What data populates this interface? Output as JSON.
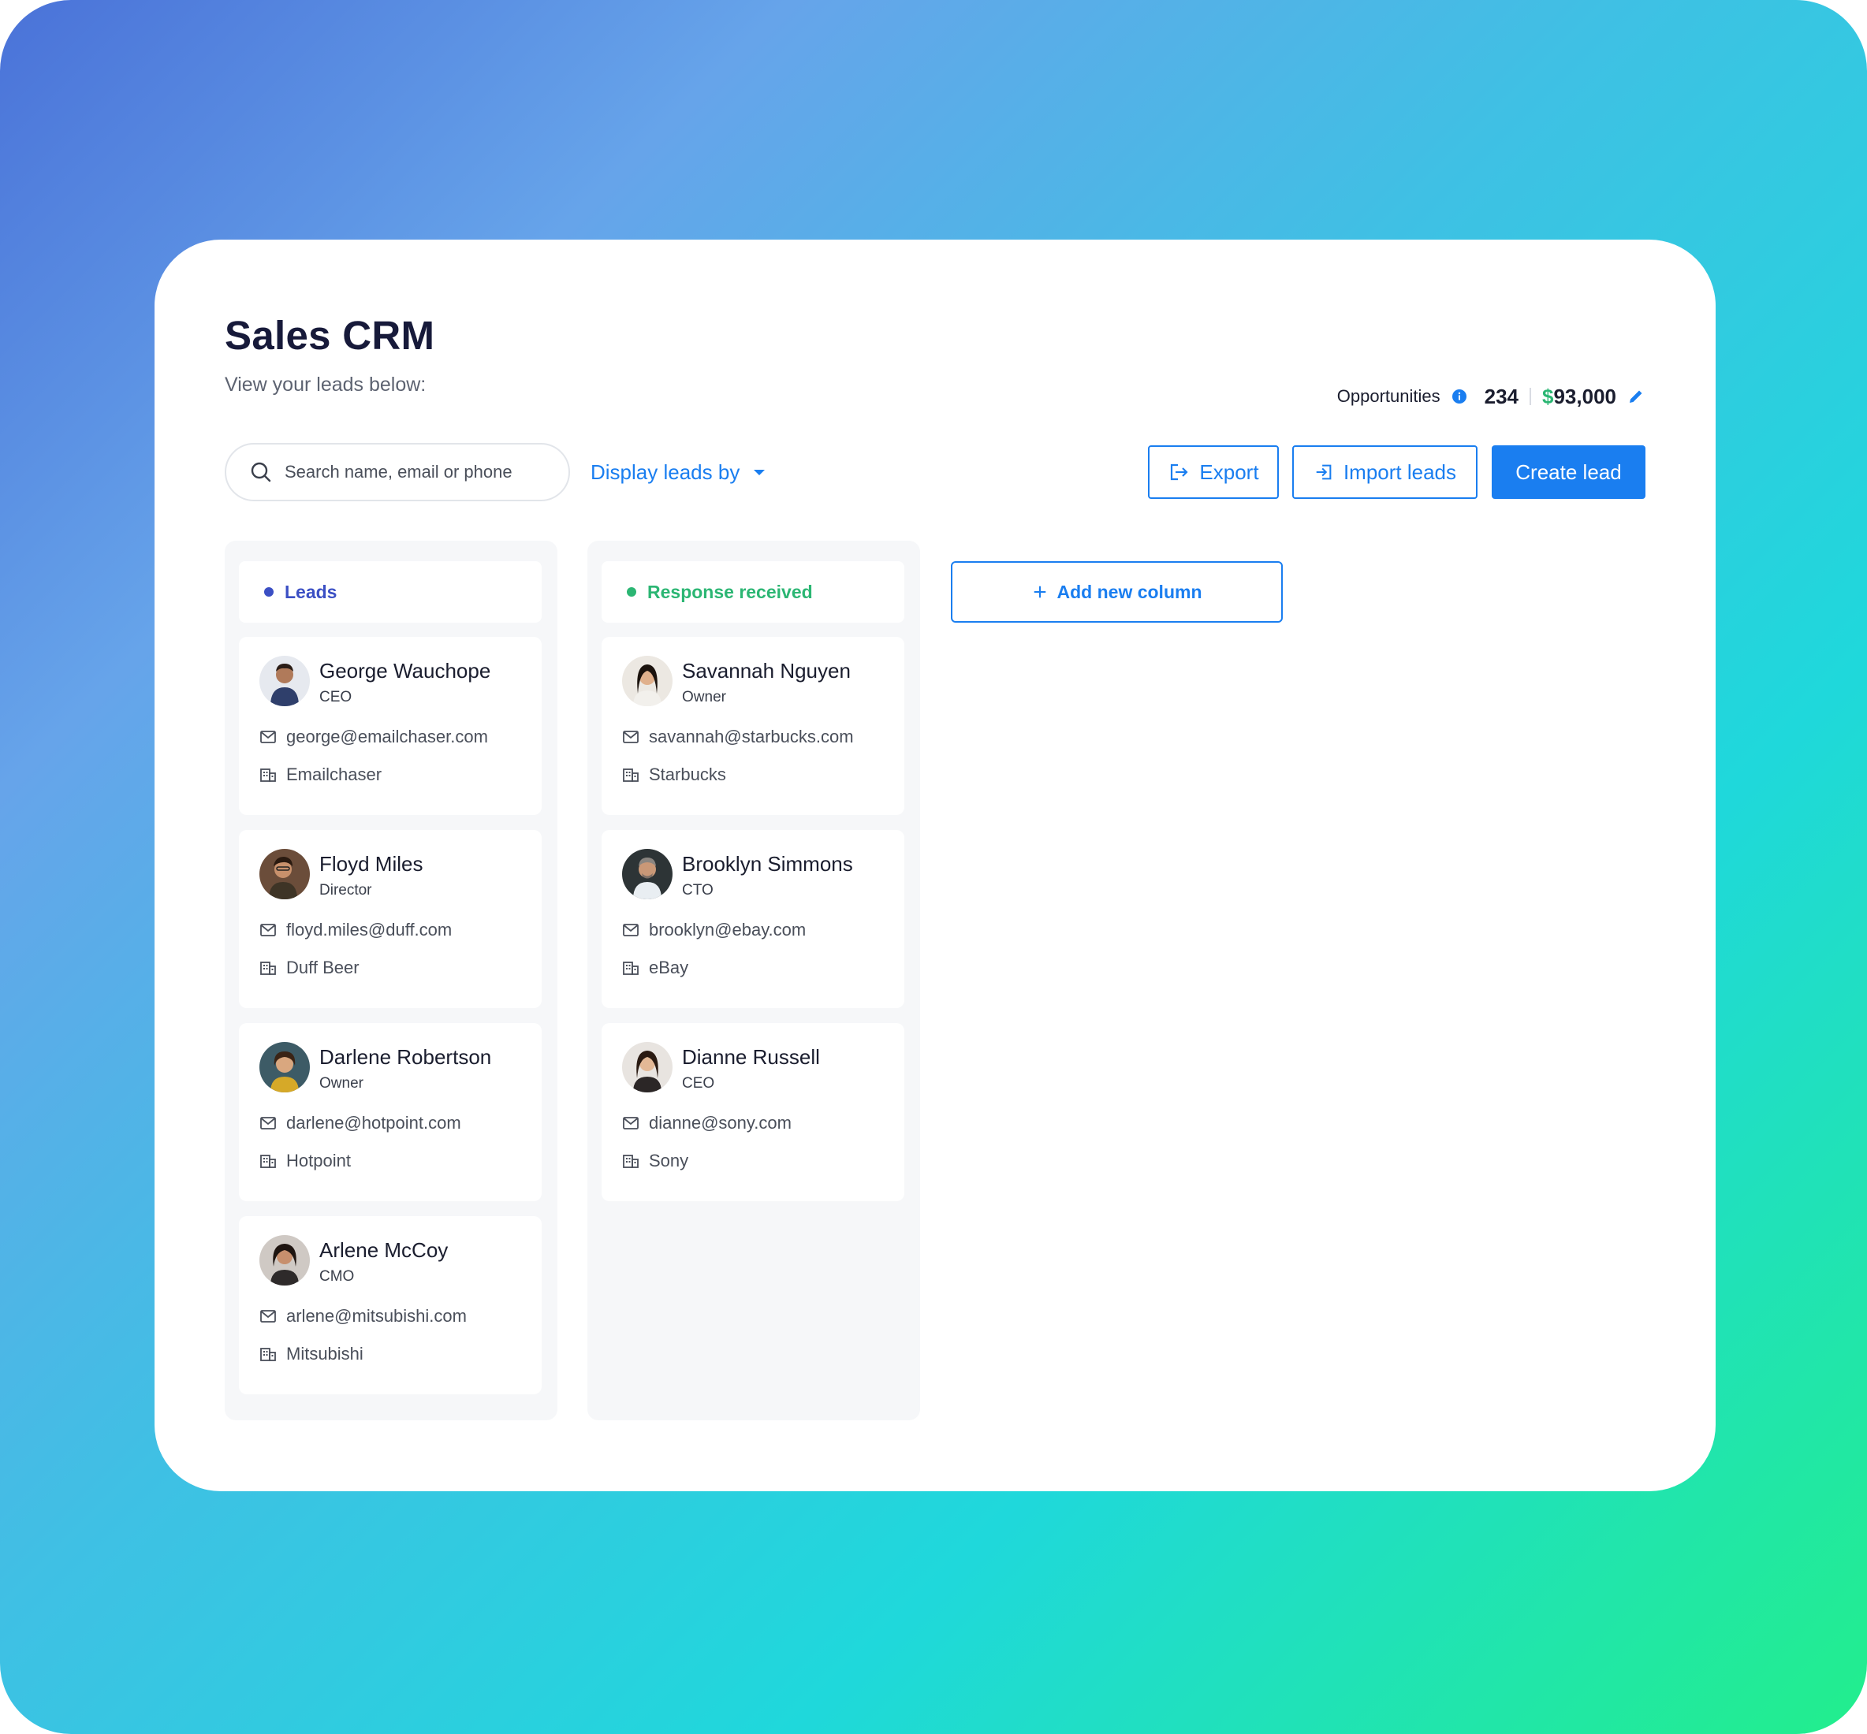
{
  "header": {
    "title": "Sales CRM",
    "subtitle": "View your leads below:"
  },
  "opportunities": {
    "label": "Opportunities",
    "count": "234",
    "value_symbol": "$",
    "value_amount": "93,000"
  },
  "toolbar": {
    "search_placeholder": "Search name, email or phone",
    "display_by_label": "Display leads by",
    "export_label": "Export",
    "import_label": "Import leads",
    "create_label": "Create lead",
    "add_column_label": "Add new column"
  },
  "colors": {
    "accent": "#1a7ef0",
    "leads_status": "#3b4fc4",
    "response_status": "#2bb673"
  },
  "columns": [
    {
      "title": "Leads",
      "leads": [
        {
          "name": "George Wauchope",
          "role": "CEO",
          "email": "george@emailchaser.com",
          "company": "Emailchaser"
        },
        {
          "name": "Floyd Miles",
          "role": "Director",
          "email": "floyd.miles@duff.com",
          "company": "Duff Beer"
        },
        {
          "name": "Darlene Robertson",
          "role": "Owner",
          "email": "darlene@hotpoint.com",
          "company": "Hotpoint"
        },
        {
          "name": "Arlene McCoy",
          "role": "CMO",
          "email": "arlene@mitsubishi.com",
          "company": "Mitsubishi"
        }
      ]
    },
    {
      "title": "Response received",
      "leads": [
        {
          "name": "Savannah Nguyen",
          "role": "Owner",
          "email": "savannah@starbucks.com",
          "company": "Starbucks"
        },
        {
          "name": "Brooklyn Simmons",
          "role": "CTO",
          "email": "brooklyn@ebay.com",
          "company": "eBay"
        },
        {
          "name": "Dianne Russell",
          "role": "CEO",
          "email": "dianne@sony.com",
          "company": "Sony"
        }
      ]
    }
  ]
}
